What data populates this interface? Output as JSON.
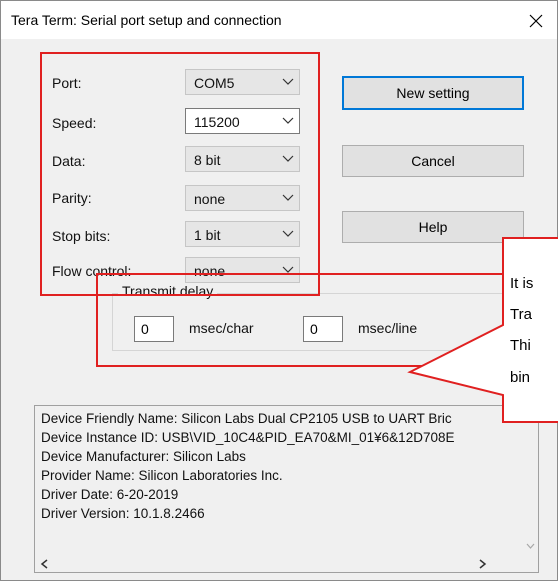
{
  "window": {
    "title": "Tera Term: Serial port setup and connection"
  },
  "settings": {
    "port": {
      "label": "Port:",
      "value": "COM5"
    },
    "speed": {
      "label": "Speed:",
      "value": "115200"
    },
    "data": {
      "label": "Data:",
      "value": "8 bit"
    },
    "parity": {
      "label": "Parity:",
      "value": "none"
    },
    "stop_bits": {
      "label": "Stop bits:",
      "value": "1 bit"
    },
    "flow_control": {
      "label": "Flow control:",
      "value": "none"
    }
  },
  "buttons": {
    "new_setting": "New setting",
    "cancel": "Cancel",
    "help": "Help"
  },
  "transmit_delay": {
    "title": "Transmit delay",
    "char_value": "0",
    "char_unit": "msec/char",
    "line_value": "0",
    "line_unit": "msec/line"
  },
  "device_info": [
    "Device Friendly Name: Silicon Labs Dual CP2105 USB to UART Bric",
    "Device Instance ID: USB\\VID_10C4&PID_EA70&MI_01¥6&12D708E",
    "Device Manufacturer: Silicon Labs",
    "Provider Name: Silicon Laboratories Inc.",
    "Driver Date: 6-20-2019",
    "Driver Version: 10.1.8.2466"
  ],
  "callout": {
    "lines": [
      "It is",
      "Tra",
      "Thi",
      "bin"
    ]
  },
  "colors": {
    "highlight": "#e02020",
    "default_button_border": "#0078d7",
    "dialog_bg": "#f0f0f0"
  }
}
